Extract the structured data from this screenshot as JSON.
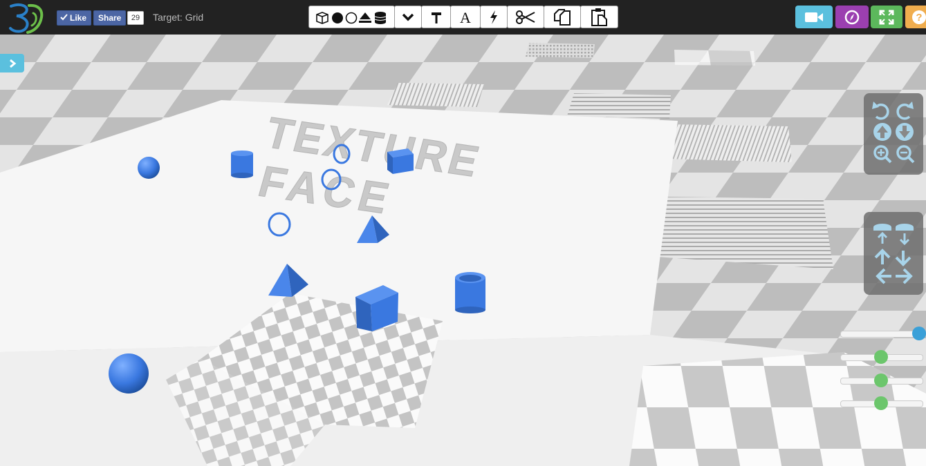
{
  "header": {
    "fb_like_label": "Like",
    "fb_share_label": "Share",
    "fb_count": "29",
    "target_label": "Target: Grid"
  },
  "toolbar": {
    "tools": [
      "cube",
      "sphere",
      "cylinder",
      "pyramid",
      "torus",
      "more",
      "paint",
      "text",
      "lightning",
      "cut",
      "copy",
      "paste"
    ]
  },
  "scene": {
    "wall_text_line1": "TEXTURE",
    "wall_text_line2": "FACE",
    "object_color": "#3a78e0"
  },
  "right_buttons": [
    {
      "name": "camera",
      "color": "#5bc0de"
    },
    {
      "name": "compass",
      "color": "#9b3fb0"
    },
    {
      "name": "fullscreen",
      "color": "#5cb85c"
    },
    {
      "name": "help",
      "color": "#f0ad4e"
    }
  ],
  "sliders": [
    {
      "name": "slider-1",
      "value": 1.0,
      "color": "#3aa0d8"
    },
    {
      "name": "slider-2",
      "value": 0.5,
      "color": "#6cc66c"
    },
    {
      "name": "slider-3",
      "value": 0.5,
      "color": "#6cc66c"
    },
    {
      "name": "slider-4",
      "value": 0.5,
      "color": "#6cc66c"
    }
  ]
}
